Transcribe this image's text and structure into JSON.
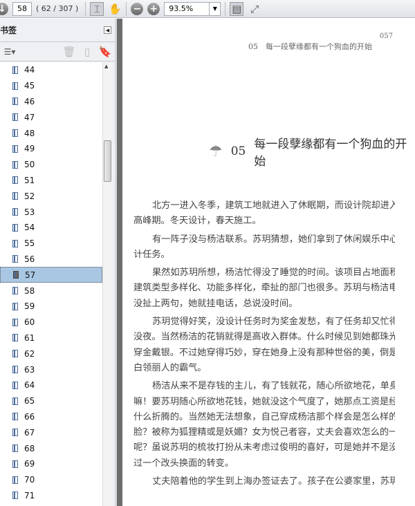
{
  "toolbar": {
    "page_input": "58",
    "page_count": "( 62 / 307 )",
    "zoom": "93.5%"
  },
  "sidebar": {
    "title": "书签",
    "bookmarks": [
      "44",
      "45",
      "46",
      "47",
      "48",
      "49",
      "50",
      "51",
      "52",
      "53",
      "54",
      "55",
      "56",
      "57",
      "58",
      "59",
      "60",
      "61",
      "62",
      "63",
      "64",
      "65",
      "66",
      "67",
      "68",
      "69",
      "70",
      "71"
    ],
    "selected": "57"
  },
  "page": {
    "running_head": "05　每一段孽缘都有一个狗血的开始",
    "page_number": "057",
    "chapter_number": "05",
    "chapter_title": "每一段孽缘都有一个狗血的开始",
    "lines": [
      {
        "t": "北方一进入冬季，建筑工地就进入了休眠期，而设计院却进入设计",
        "i": true
      },
      {
        "t": "高峰期。冬天设计，春天施工。",
        "i": false
      },
      {
        "t": "有一阵子没与杨洁联系。苏玥猜想，她们拿到了休闲娱乐中心的设",
        "i": true
      },
      {
        "t": "计任务。",
        "i": false
      },
      {
        "t": "果然如苏玥所想，杨洁忙得没了睡觉的时间。该项目占地面积大，",
        "i": true
      },
      {
        "t": "建筑类型多样化、功能多样化，牵扯的部门也很多。苏玥与杨洁电话里",
        "i": false
      },
      {
        "t": "没扯上两句，她就挂电话，总说没时间。",
        "i": false
      },
      {
        "t": "苏玥觉得好笑，没设计任务时为奖金发愁，有了任务却又忙得没日",
        "i": true
      },
      {
        "t": "没夜。当然杨洁的花销就得是高收入群体。什么时候见到她都珠光宝气，",
        "i": false
      },
      {
        "t": "穿金戴银。不过她穿得巧妙，穿在她身上没有那种世俗的美，倒是颇有",
        "i": false
      },
      {
        "t": "白领丽人的霸气。",
        "i": false
      },
      {
        "t": "杨洁从来不是存钱的主儿，有了钱就花，随心所欲地花，单身贵族",
        "i": true
      },
      {
        "t": "嘛！要苏玥随心所欲地花钱，她就没这个气度了，她那点工资是经不起",
        "i": false
      },
      {
        "t": "什么折腾的。当然她无法想象，自己穿成杨洁那个样会是怎么样的一张",
        "i": false
      },
      {
        "t": "脸？被称为狐狸精或是妖媚？女为悦己者容，丈夫会喜欢怎么的一张脸",
        "i": false
      },
      {
        "t": "呢？虽说苏玥的梳妆打扮从未考虑过俊明的喜好，可是她并不是没有想",
        "i": false
      },
      {
        "t": "过一个改头换面的转变。",
        "i": false
      },
      {
        "t": "丈夫陪着他的学生到上海办签证去了。孩子在公婆家里，苏玥感到",
        "i": true
      }
    ]
  }
}
